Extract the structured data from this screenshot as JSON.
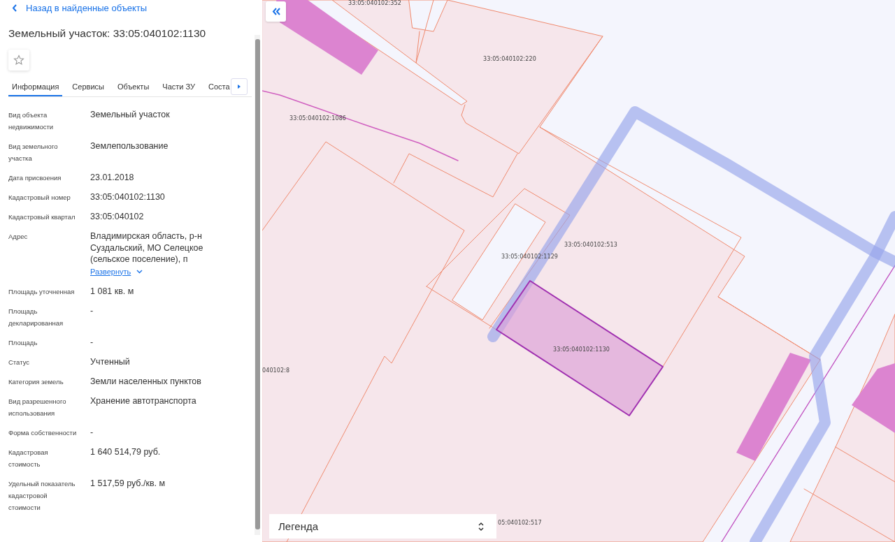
{
  "panel": {
    "back_link": "Назад в найденные объекты",
    "title": "Земельный участок: 33:05:040102:1130",
    "favorite": false,
    "tabs": [
      {
        "label": "Информация",
        "selected": true
      },
      {
        "label": "Сервисы",
        "selected": false
      },
      {
        "label": "Объекты",
        "selected": false
      },
      {
        "label": "Части ЗУ",
        "selected": false
      },
      {
        "label": "Соста",
        "selected": false
      }
    ],
    "fields": [
      {
        "label": "Вид объекта недвижимости",
        "value": "Земельный участок"
      },
      {
        "label": "Вид земельного участка",
        "value": "Землепользование"
      },
      {
        "label": "Дата присвоения",
        "value": "23.01.2018"
      },
      {
        "label": "Кадастровый номер",
        "value": "33:05:040102:1130"
      },
      {
        "label": "Кадастровый квартал",
        "value": "33:05:040102"
      },
      {
        "label": "Адрес",
        "value": "Владимирская область, р-н Суздальский, МО Селецкое (сельское поселение), п",
        "expand_link": "Развернуть"
      },
      {
        "label": "Площадь уточненная",
        "value": "1 081 кв. м"
      },
      {
        "label": "Площадь декларированная",
        "value": "-"
      },
      {
        "label": "Площадь",
        "value": "-"
      },
      {
        "label": "Статус",
        "value": "Учтенный"
      },
      {
        "label": "Категория земель",
        "value": "Земли населенных пунктов"
      },
      {
        "label": "Вид разрешенного использования",
        "value": "Хранение автотранспорта"
      },
      {
        "label": "Форма собственности",
        "value": "-"
      },
      {
        "label": "Кадастровая стоимость",
        "value": "1 640 514,79 руб."
      },
      {
        "label": "Удельный показатель кадастровой стоимости",
        "value": "1 517,59 руб./кв. м"
      }
    ]
  },
  "map": {
    "parcel_labels": [
      "33:05:040102:352",
      "33:05:040102:220",
      "33:05:040102:1086",
      "33:05:040102:513",
      "33:05:040102:1129",
      "33:05:040102:1130",
      "040102:8",
      "05:040102:517"
    ],
    "legend": {
      "label": "Легенда",
      "expanded": false
    }
  }
}
